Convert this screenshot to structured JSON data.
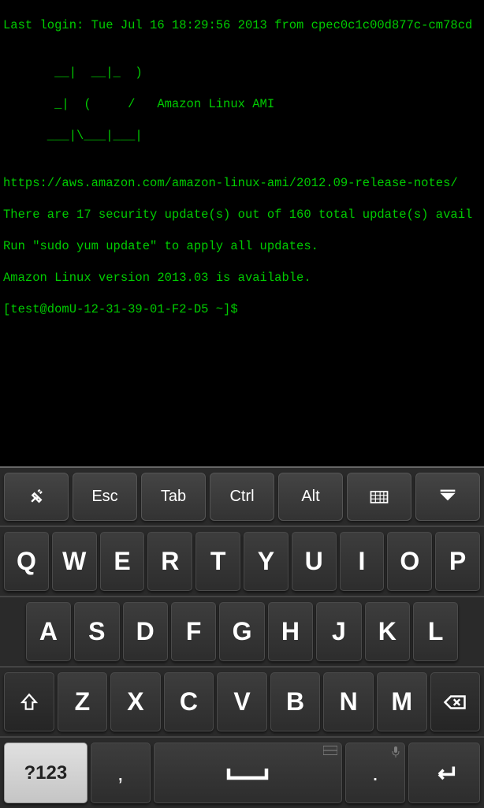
{
  "terminal": {
    "lines": [
      "Last login: Tue Jul 16 18:29:56 2013 from cpec0c1c00d877c-cm78cd",
      "",
      "       __|  __|_  )",
      "       _|  (     /   Amazon Linux AMI",
      "      ___|\\___|___|",
      "",
      "https://aws.amazon.com/amazon-linux-ami/2012.09-release-notes/",
      "There are 17 security update(s) out of 160 total update(s) avail",
      "Run \"sudo yum update\" to apply all updates.",
      "Amazon Linux version 2013.03 is available.",
      "[test@domU-12-31-39-01-F2-D5 ~]$"
    ]
  },
  "toolbar": {
    "esc": "Esc",
    "tab": "Tab",
    "ctrl": "Ctrl",
    "alt": "Alt"
  },
  "keys": {
    "row1": [
      "Q",
      "W",
      "E",
      "R",
      "T",
      "Y",
      "U",
      "I",
      "O",
      "P"
    ],
    "row2": [
      "A",
      "S",
      "D",
      "F",
      "G",
      "H",
      "J",
      "K",
      "L"
    ],
    "row3": [
      "Z",
      "X",
      "C",
      "V",
      "B",
      "N",
      "M"
    ],
    "sym": "?123",
    "comma": ",",
    "period": "."
  }
}
